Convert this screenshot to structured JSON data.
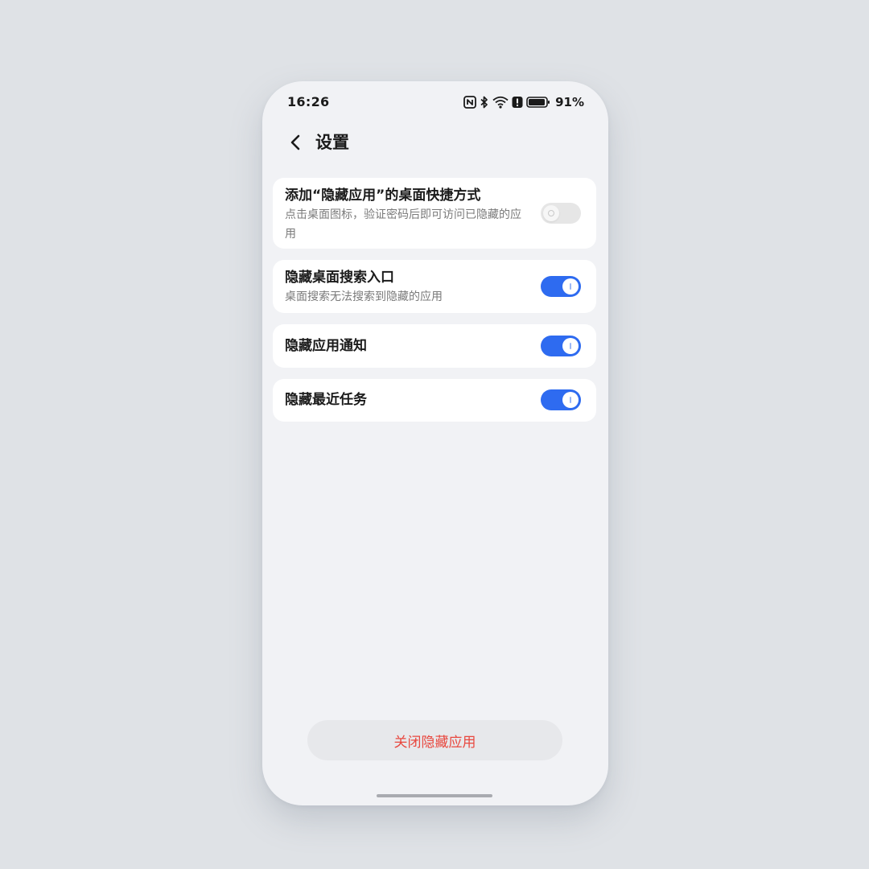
{
  "status_bar": {
    "time": "16:26",
    "battery_percent": "91%",
    "icons": [
      "nfc-icon",
      "bluetooth-icon",
      "wifi-icon",
      "alert-icon",
      "battery-icon"
    ]
  },
  "header": {
    "back_icon": "chevron-left-icon",
    "title": "设置"
  },
  "settings": [
    {
      "title": "添加“隐藏应用”的桌面快捷方式",
      "description": "点击桌面图标，验证密码后即可访问已隐藏的应用",
      "enabled": false
    },
    {
      "title": "隐藏桌面搜索入口",
      "description": "桌面搜索无法搜索到隐藏的应用",
      "enabled": true
    },
    {
      "title": "隐藏应用通知",
      "description": "",
      "enabled": true
    },
    {
      "title": "隐藏最近任务",
      "description": "",
      "enabled": true
    }
  ],
  "bottom_button": {
    "label": "关闭隐藏应用"
  },
  "colors": {
    "accent": "#2e6bf0",
    "danger": "#e8483f",
    "background": "#f1f2f5",
    "card": "#ffffff"
  }
}
